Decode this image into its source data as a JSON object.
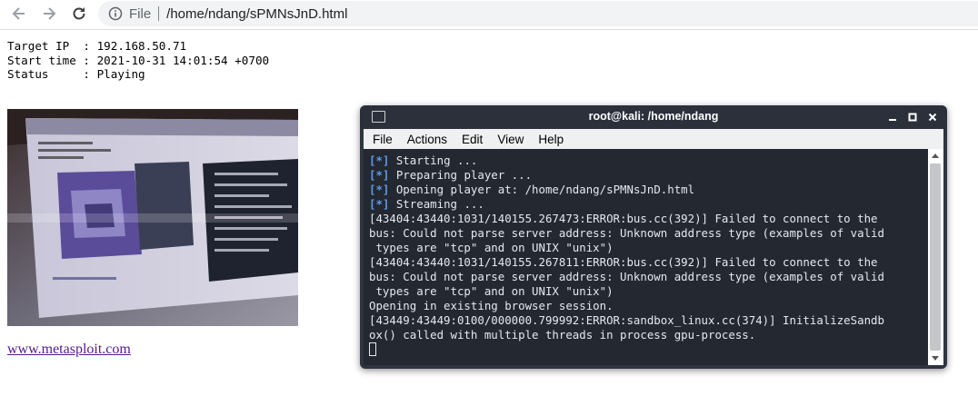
{
  "browser": {
    "scheme_label": "File",
    "url": "/home/ndang/sPMNsJnD.html",
    "icons": [
      "back-arrow-icon",
      "forward-arrow-icon",
      "reload-icon",
      "info-icon"
    ]
  },
  "page": {
    "info_lines": [
      "Target IP  : 192.168.50.71",
      "Start time : 2021-10-31 14:01:54 +0700",
      "Status     : Playing"
    ],
    "link_text": "www.metasploit.com"
  },
  "terminal": {
    "title": "root@kali: /home/ndang",
    "menu": [
      "File",
      "Actions",
      "Edit",
      "View",
      "Help"
    ],
    "status_lines": [
      {
        "bullet": "[*]",
        "text": " Starting ..."
      },
      {
        "bullet": "[*]",
        "text": " Preparing player ..."
      },
      {
        "bullet": "[*]",
        "text": " Opening player at: /home/ndang/sPMNsJnD.html"
      },
      {
        "bullet": "[*]",
        "text": " Streaming ..."
      }
    ],
    "log_lines": [
      "[43404:43440:1031/140155.267473:ERROR:bus.cc(392)] Failed to connect to the",
      "bus: Could not parse server address: Unknown address type (examples of valid",
      " types are \"tcp\" and on UNIX \"unix\")",
      "[43404:43440:1031/140155.267811:ERROR:bus.cc(392)] Failed to connect to the",
      "bus: Could not parse server address: Unknown address type (examples of valid",
      " types are \"tcp\" and on UNIX \"unix\")",
      "Opening in existing browser session.",
      "[43449:43449:0100/000000.799992:ERROR:sandbox_linux.cc(374)] InitializeSandb",
      "ox() called with multiple threads in process gpu-process."
    ]
  },
  "colors": {
    "terminal_bg": "#232831",
    "bullet": "#5e9be6",
    "visited_link": "#551a8b"
  }
}
